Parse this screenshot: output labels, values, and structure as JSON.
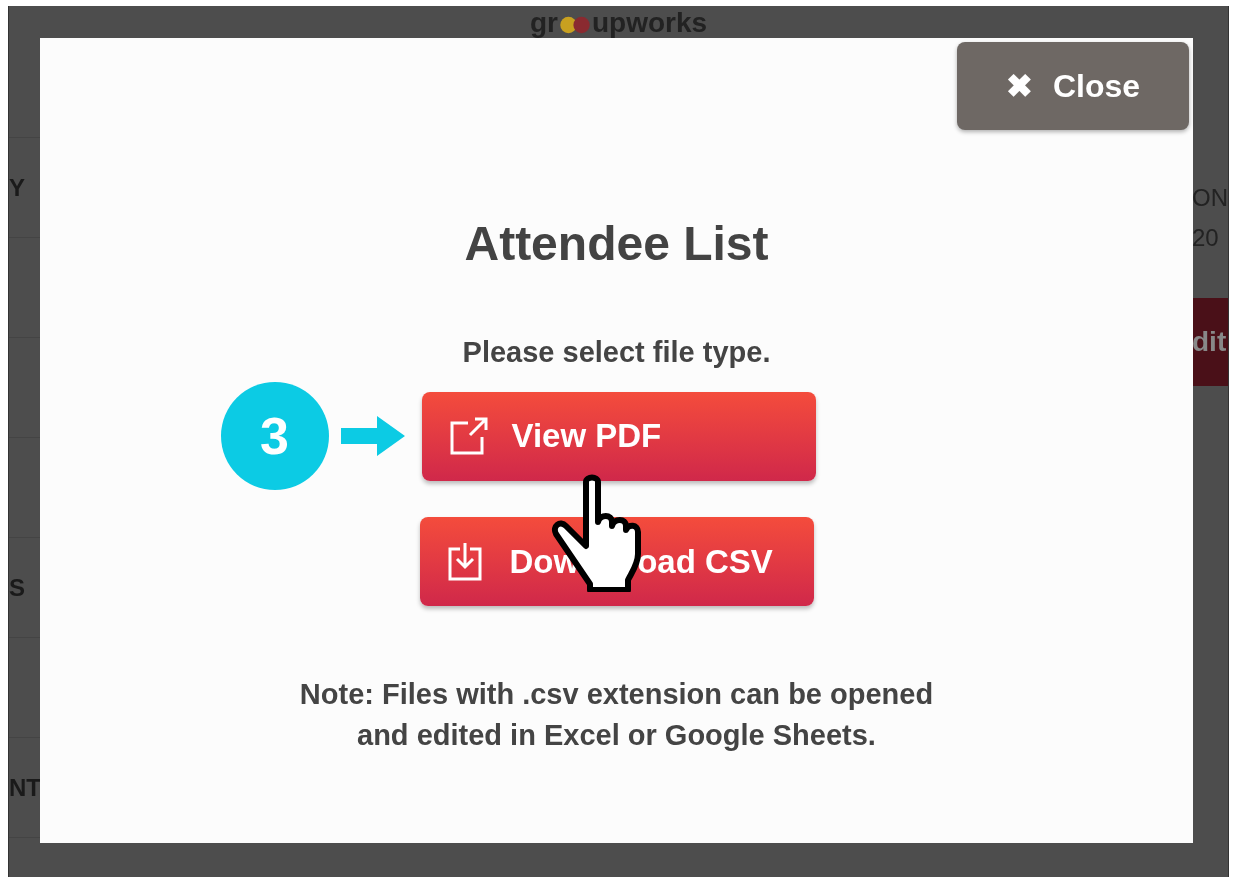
{
  "background": {
    "logo": {
      "before": "gr",
      "after": "upworks"
    },
    "left_column": [
      "Y",
      "S",
      "NT"
    ],
    "right_column": {
      "texts": [
        "ON",
        "20"
      ],
      "button": "dit"
    }
  },
  "modal": {
    "close_button": {
      "icon": "✖",
      "label": "Close"
    },
    "title": "Attendee List",
    "prompt": "Please select file type.",
    "step": {
      "number": "3"
    },
    "buttons": [
      {
        "kind": "view",
        "label": "View PDF"
      },
      {
        "kind": "download",
        "label_parts": [
          "Dow",
          "oad CSV"
        ]
      }
    ],
    "note": [
      "Note: Files with .csv extension can be opened",
      "and edited in Excel or Google Sheets."
    ]
  }
}
